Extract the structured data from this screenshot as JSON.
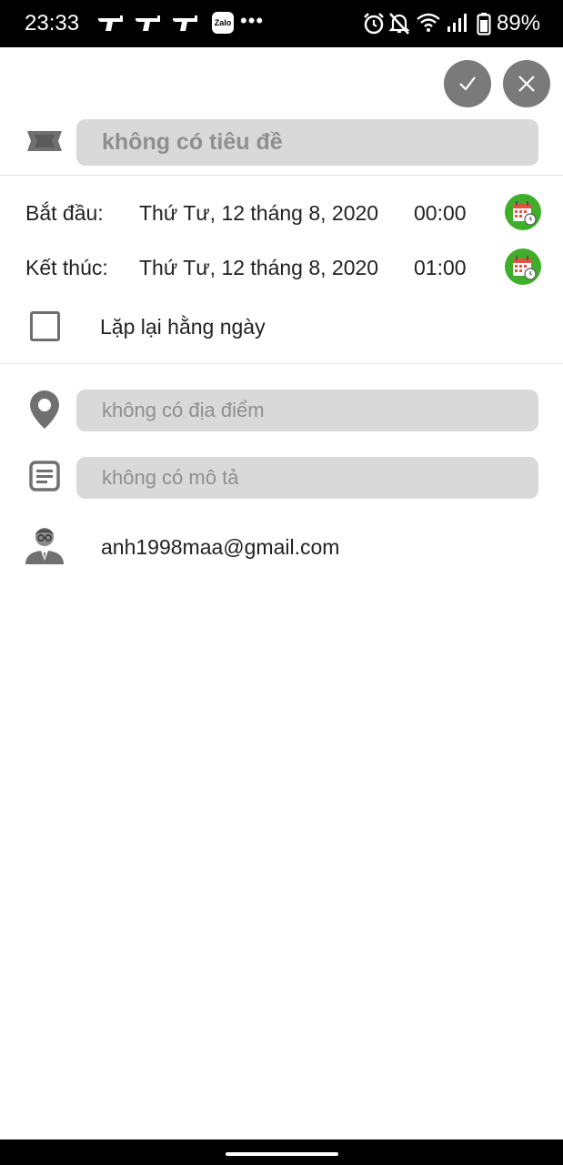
{
  "status_bar": {
    "time": "23:33",
    "zalo_label": "Zalo",
    "more_notifications": "•••",
    "battery": "89%",
    "icons": [
      "rifle-icon",
      "rifle-icon",
      "rifle-icon",
      "zalo-icon",
      "alarm-icon",
      "bell-off-icon",
      "wifi-icon",
      "signal-icon",
      "battery-icon"
    ]
  },
  "toolbar": {
    "confirm_icon": "check-icon",
    "close_icon": "close-icon"
  },
  "event": {
    "title_placeholder": "không có tiêu đề",
    "start": {
      "label": "Bắt đầu:",
      "date": "Thứ Tư, 12 tháng 8, 2020",
      "time": "00:00"
    },
    "end": {
      "label": "Kết thúc:",
      "date": "Thứ Tư, 12 tháng 8, 2020",
      "time": "01:00"
    },
    "repeat_label": "Lặp lại hằng ngày",
    "repeat_checked": false,
    "location_placeholder": "không có địa điểm",
    "description_placeholder": "không có mô tả",
    "organizer_email": "anh1998maa@gmail.com"
  },
  "colors": {
    "accent_green": "#3fae2a",
    "button_gray": "#7a7a7a",
    "field_gray": "#d9d9d9",
    "placeholder_gray": "#8f8f8f",
    "icon_gray": "#707070"
  }
}
